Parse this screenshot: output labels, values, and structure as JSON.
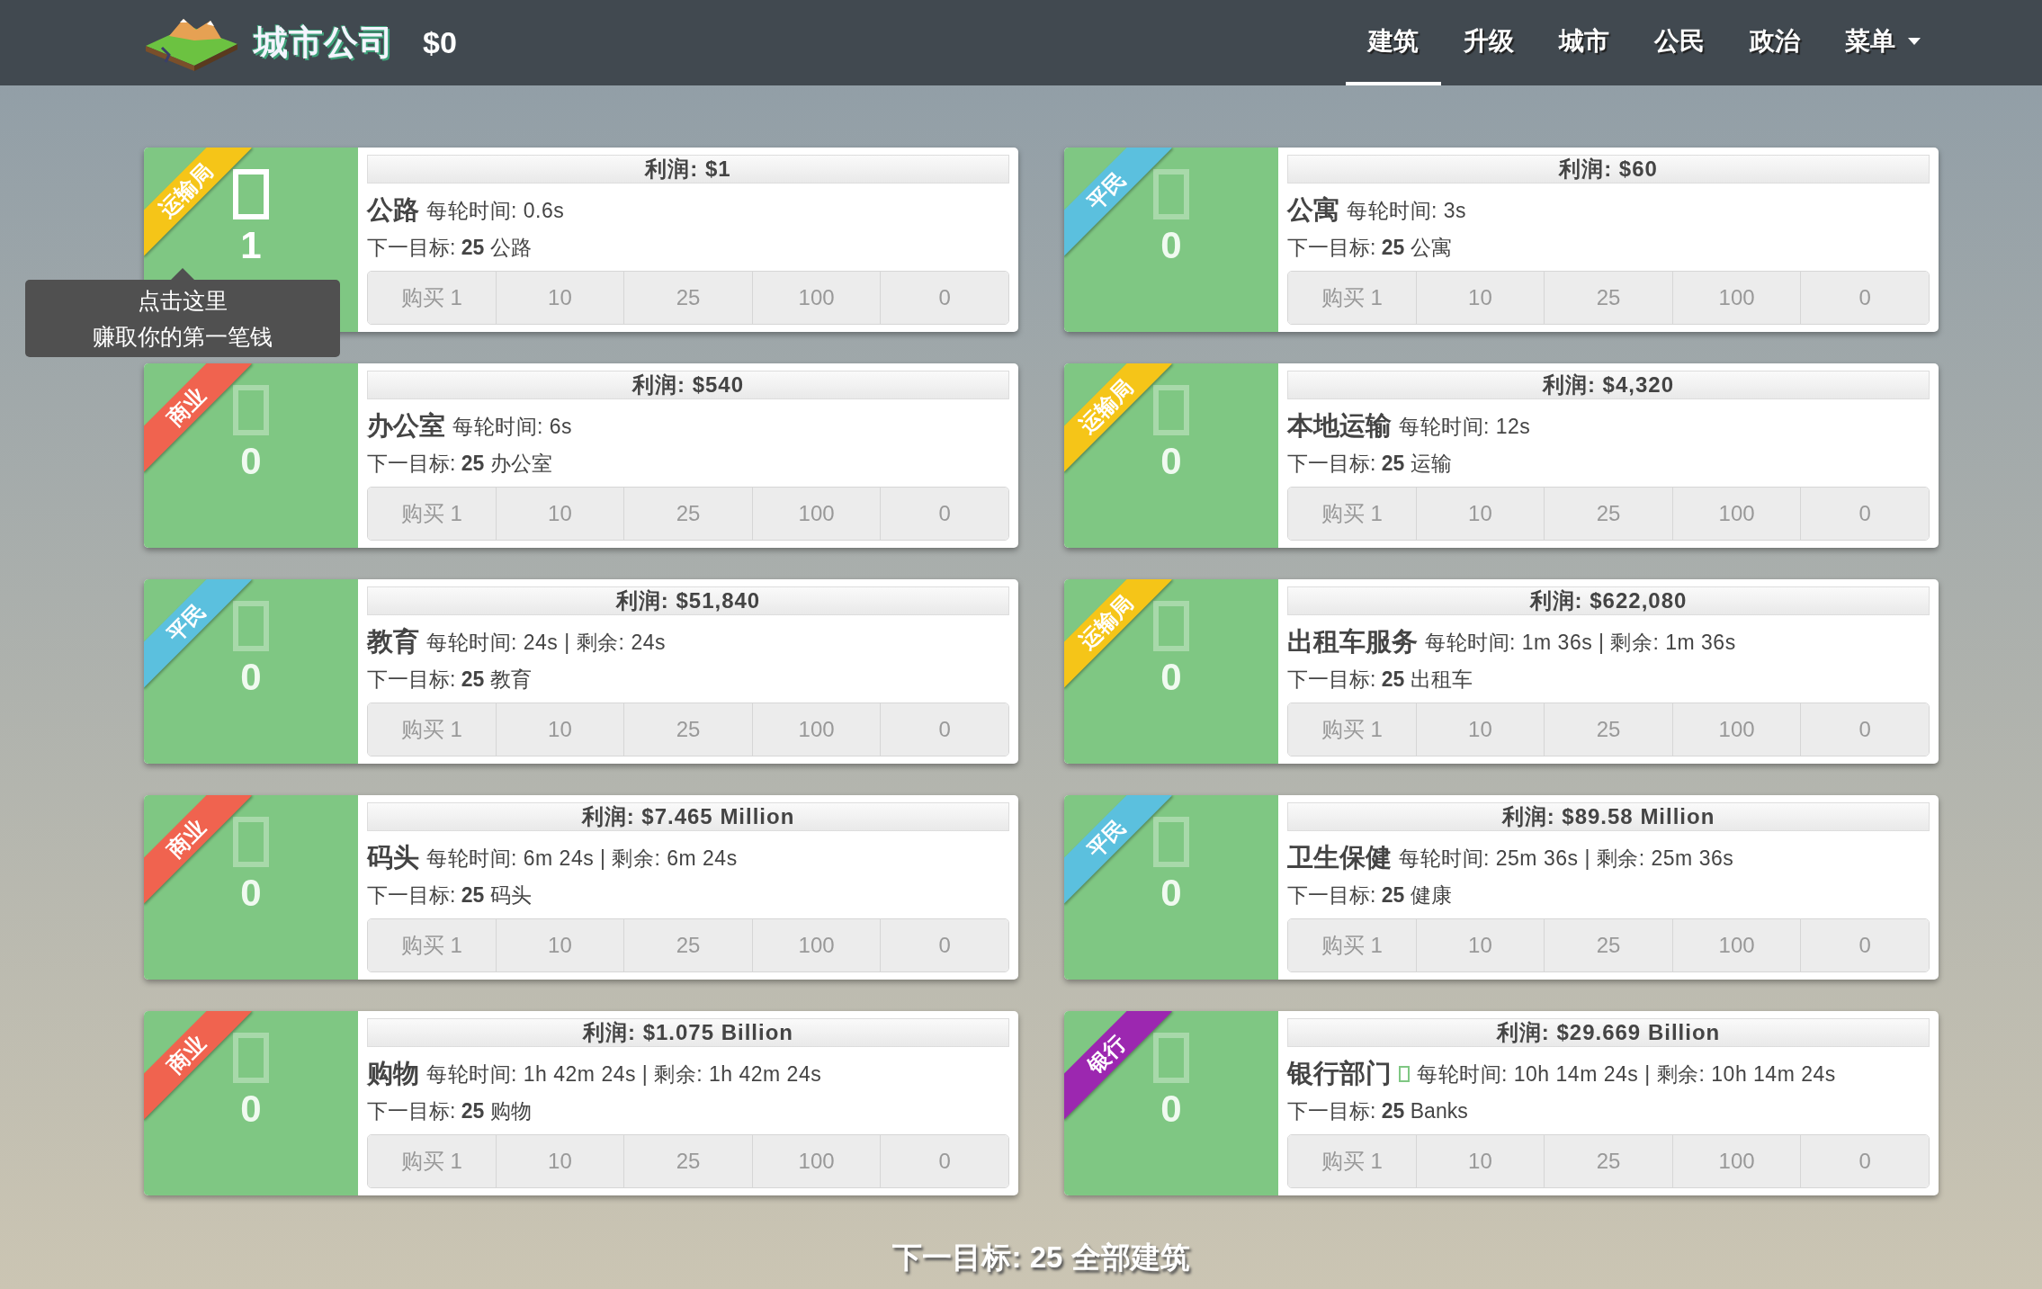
{
  "navbar": {
    "title": "城市公司",
    "money": "$0",
    "tabs": [
      {
        "label": "建筑",
        "selected": true
      },
      {
        "label": "升级",
        "selected": false
      },
      {
        "label": "城市",
        "selected": false
      },
      {
        "label": "公民",
        "selected": false
      },
      {
        "label": "政治",
        "selected": false
      }
    ],
    "menu": {
      "label": "菜单"
    }
  },
  "buildings": [
    {
      "category": "运输局",
      "color": "#f5c518",
      "active": true,
      "count": "1",
      "profit": "利润: $1",
      "name": "公路",
      "badge_icon": false,
      "cycle": "每轮时间: 0.6s",
      "target": "下一目标: **25** 公路",
      "buttons": [
        "购买 1",
        "10",
        "25",
        "100",
        "0"
      ]
    },
    {
      "category": "平民",
      "color": "#5bc0de",
      "active": false,
      "count": "0",
      "profit": "利润: $60",
      "name": "公寓",
      "badge_icon": false,
      "cycle": "每轮时间: 3s",
      "target": "下一目标: **25** 公寓",
      "buttons": [
        "购买 1",
        "10",
        "25",
        "100",
        "0"
      ]
    },
    {
      "category": "商业",
      "color": "#f0634f",
      "active": false,
      "count": "0",
      "profit": "利润: $540",
      "name": "办公室",
      "badge_icon": false,
      "cycle": "每轮时间: 6s",
      "target": "下一目标: **25** 办公室",
      "buttons": [
        "购买 1",
        "10",
        "25",
        "100",
        "0"
      ]
    },
    {
      "category": "运输局",
      "color": "#f5c518",
      "active": false,
      "count": "0",
      "profit": "利润: $4,320",
      "name": "本地运输",
      "badge_icon": false,
      "cycle": "每轮时间: 12s",
      "target": "下一目标: **25** 运输",
      "buttons": [
        "购买 1",
        "10",
        "25",
        "100",
        "0"
      ]
    },
    {
      "category": "平民",
      "color": "#5bc0de",
      "active": false,
      "count": "0",
      "profit": "利润: $51,840",
      "name": "教育",
      "badge_icon": false,
      "cycle": "每轮时间: 24s | 剩余: 24s",
      "target": "下一目标: **25** 教育",
      "buttons": [
        "购买 1",
        "10",
        "25",
        "100",
        "0"
      ]
    },
    {
      "category": "运输局",
      "color": "#f5c518",
      "active": false,
      "count": "0",
      "profit": "利润: $622,080",
      "name": "出租车服务",
      "badge_icon": false,
      "cycle": "每轮时间: 1m 36s | 剩余: 1m 36s",
      "target": "下一目标: **25** 出租车",
      "buttons": [
        "购买 1",
        "10",
        "25",
        "100",
        "0"
      ]
    },
    {
      "category": "商业",
      "color": "#f0634f",
      "active": false,
      "count": "0",
      "profit": "利润: $7.465 Million",
      "name": "码头",
      "badge_icon": false,
      "cycle": "每轮时间: 6m 24s | 剩余: 6m 24s",
      "target": "下一目标: **25** 码头",
      "buttons": [
        "购买 1",
        "10",
        "25",
        "100",
        "0"
      ]
    },
    {
      "category": "平民",
      "color": "#5bc0de",
      "active": false,
      "count": "0",
      "profit": "利润: $89.58 Million",
      "name": "卫生保健",
      "badge_icon": false,
      "cycle": "每轮时间: 25m 36s | 剩余: 25m 36s",
      "target": "下一目标: **25** 健康",
      "buttons": [
        "购买 1",
        "10",
        "25",
        "100",
        "0"
      ]
    },
    {
      "category": "商业",
      "color": "#f0634f",
      "active": false,
      "count": "0",
      "profit": "利润: $1.075 Billion",
      "name": "购物",
      "badge_icon": false,
      "cycle": "每轮时间: 1h 42m 24s | 剩余: 1h 42m 24s",
      "target": "下一目标: **25** 购物",
      "buttons": [
        "购买 1",
        "10",
        "25",
        "100",
        "0"
      ]
    },
    {
      "category": "银行",
      "color": "#9c27b0",
      "active": false,
      "count": "0",
      "profit": "利润: $29.669 Billion",
      "name": "银行部门",
      "badge_icon": true,
      "cycle": "每轮时间: 10h 14m 24s | 剩余: 10h 14m 24s",
      "target": "下一目标: **25** Banks",
      "buttons": [
        "购买 1",
        "10",
        "25",
        "100",
        "0"
      ]
    }
  ],
  "tooltip": {
    "lines": [
      "点击这里",
      "赚取你的第一笔钱"
    ]
  },
  "footer": "下一目标: 25 全部建筑"
}
